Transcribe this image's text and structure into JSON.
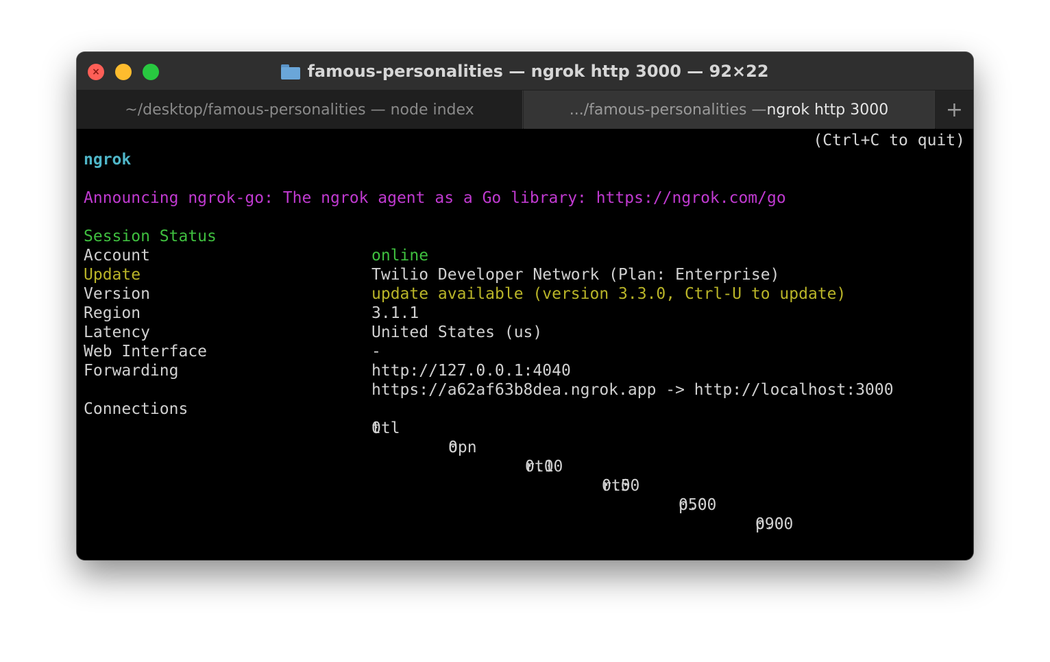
{
  "window": {
    "title": "famous-personalities — ngrok http 3000 — 92×22"
  },
  "tabs": [
    {
      "label": "~/desktop/famous-personalities — node index",
      "active": false
    },
    {
      "label_prefix": ".../famous-personalities — ",
      "label_strong": "ngrok http 3000",
      "active": true
    }
  ],
  "tab_add_label": "+",
  "terminal": {
    "app_name": "ngrok",
    "quit_hint": "(Ctrl+C to quit)",
    "announcement": "Announcing ngrok-go: The ngrok agent as a Go library: https://ngrok.com/go",
    "status": {
      "session_status_label": "Session Status",
      "session_status_value": "online",
      "account_label": "Account",
      "account_value": "Twilio Developer Network (Plan: Enterprise)",
      "update_label": "Update",
      "update_value": "update available (version 3.3.0, Ctrl-U to update)",
      "version_label": "Version",
      "version_value": "3.1.1",
      "region_label": "Region",
      "region_value": "United States (us)",
      "latency_label": "Latency",
      "latency_value": "-",
      "web_interface_label": "Web Interface",
      "web_interface_value": "http://127.0.0.1:4040",
      "forwarding_label": "Forwarding",
      "forwarding_value": "https://a62af63b8dea.ngrok.app -> http://localhost:3000"
    },
    "connections": {
      "label": "Connections",
      "headers": [
        "ttl",
        "opn",
        "rt1",
        "rt5",
        "p50",
        "p90"
      ],
      "values": [
        "0",
        "0",
        "0.00",
        "0.00",
        "0.00",
        "0.00"
      ]
    }
  },
  "colors": {
    "close": "#ff5f57",
    "minimize": "#febc2e",
    "zoom": "#28c840",
    "ngrok_cyan": "#4fb6c8",
    "announce_magenta": "#c03ad0",
    "online_green": "#3fbf3f",
    "update_yellow": "#b9b428"
  }
}
